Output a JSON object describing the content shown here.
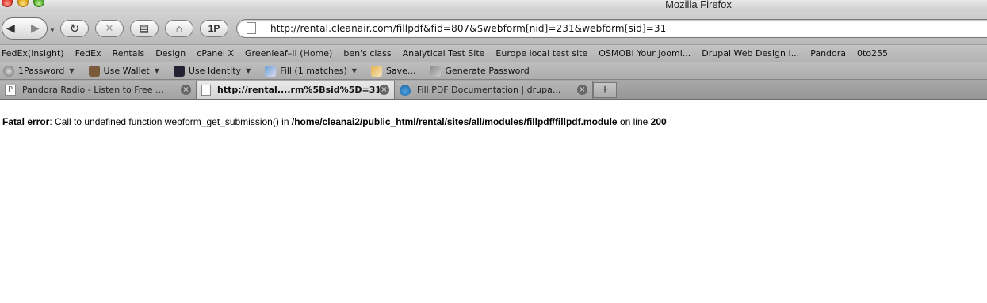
{
  "window": {
    "title": "Mozilla Firefox"
  },
  "toolbar": {
    "back_icon": "back-arrow-icon",
    "forward_icon": "forward-arrow-icon",
    "reload_icon": "reload-icon",
    "stop_icon": "stop-icon",
    "print_icon": "print-icon",
    "home_icon": "home-icon",
    "onepassword_label": "1P",
    "url": "http://rental.cleanair.com/fillpdf&fid=807&$webform[nid]=231&webform[sid]=31"
  },
  "bookmarks": [
    "FedEx(insight)",
    "FedEx",
    "Rentals",
    "Design",
    "cPanel X",
    "Greenleaf–II (Home)",
    "ben's class",
    "Analytical Test Site",
    "Europe local test site",
    "OSMOBI Your Jooml...",
    "Drupal Web Design I...",
    "Pandora",
    "0to255"
  ],
  "password_bar": {
    "onepassword": "1Password",
    "wallet": "Use Wallet",
    "identity": "Use Identity",
    "fill": "Fill (1 matches)",
    "save": "Save...",
    "generate": "Generate Password"
  },
  "tabs": [
    {
      "title": "Pandora Radio - Listen to Free ...",
      "favicon": "P"
    },
    {
      "title": "http://rental....rm%5Bsid%5D=31",
      "favicon": ""
    },
    {
      "title": "Fill PDF Documentation | drupa...",
      "favicon": ""
    }
  ],
  "new_tab_label": "+",
  "error": {
    "label": "Fatal error",
    "message": ": Call to undefined function webform_get_submission() in ",
    "path": "/home/cleanai2/public_html/rental/sites/all/modules/fillpdf/fillpdf.module",
    "on_line": " on line ",
    "line": "200"
  }
}
